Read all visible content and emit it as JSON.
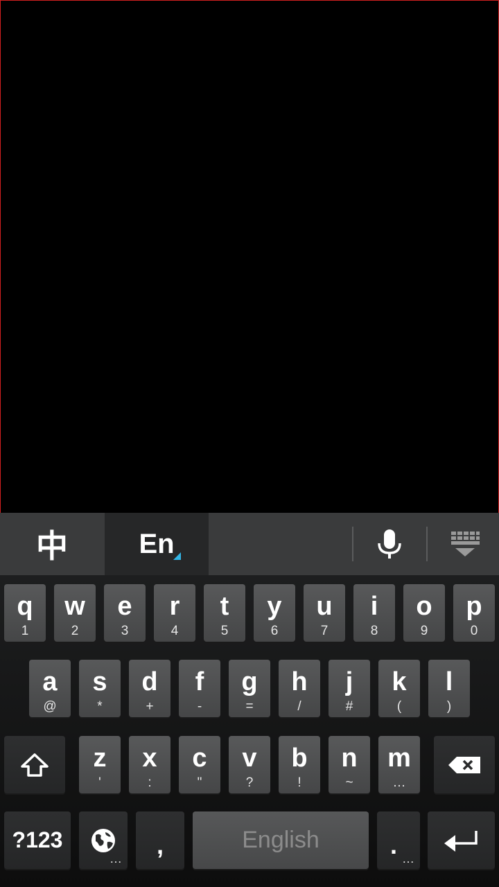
{
  "ime_bar": {
    "chinese_mode_label": "中",
    "english_mode_label": "En",
    "accent_color": "#33b5e5",
    "mic_icon": "microphone-icon",
    "hide_icon": "hide-keyboard-icon"
  },
  "rows": {
    "row1": [
      {
        "main": "q",
        "sub": "1"
      },
      {
        "main": "w",
        "sub": "2"
      },
      {
        "main": "e",
        "sub": "3"
      },
      {
        "main": "r",
        "sub": "4"
      },
      {
        "main": "t",
        "sub": "5"
      },
      {
        "main": "y",
        "sub": "6"
      },
      {
        "main": "u",
        "sub": "7"
      },
      {
        "main": "i",
        "sub": "8"
      },
      {
        "main": "o",
        "sub": "9"
      },
      {
        "main": "p",
        "sub": "0"
      }
    ],
    "row2": [
      {
        "main": "a",
        "sub": "@"
      },
      {
        "main": "s",
        "sub": "*"
      },
      {
        "main": "d",
        "sub": "+"
      },
      {
        "main": "f",
        "sub": "-"
      },
      {
        "main": "g",
        "sub": "="
      },
      {
        "main": "h",
        "sub": "/"
      },
      {
        "main": "j",
        "sub": "#"
      },
      {
        "main": "k",
        "sub": "("
      },
      {
        "main": "l",
        "sub": ")"
      }
    ],
    "row3": [
      {
        "main": "z",
        "sub": "'"
      },
      {
        "main": "x",
        "sub": ":"
      },
      {
        "main": "c",
        "sub": "\""
      },
      {
        "main": "v",
        "sub": "?"
      },
      {
        "main": "b",
        "sub": "!"
      },
      {
        "main": "n",
        "sub": "~"
      },
      {
        "main": "m",
        "sub": "…"
      }
    ]
  },
  "bottom": {
    "symbols_label": "?123",
    "globe_more": "…",
    "comma_label": ",",
    "space_label": "English",
    "period_label": ".",
    "period_more": "…"
  }
}
